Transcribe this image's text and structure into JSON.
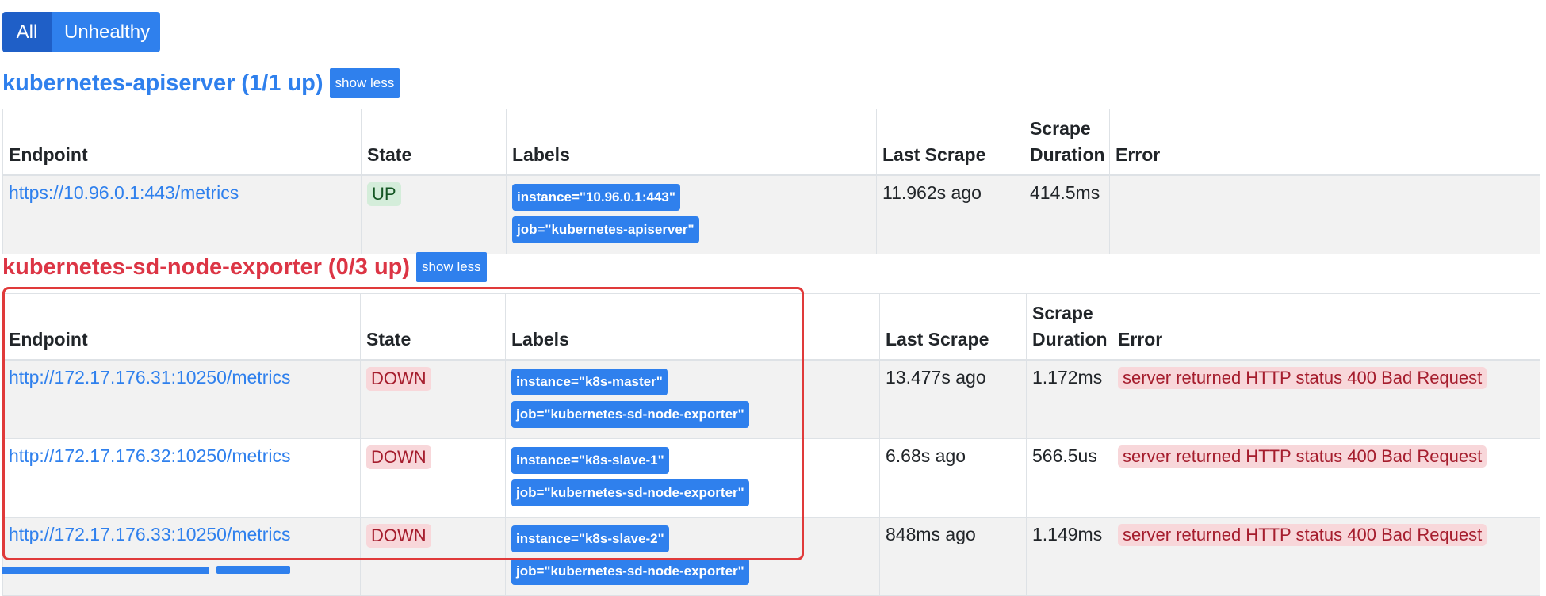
{
  "filters": {
    "all_label": "All",
    "unhealthy_label": "Unhealthy"
  },
  "columns": {
    "endpoint": "Endpoint",
    "state": "State",
    "labels": "Labels",
    "last_scrape": "Last Scrape",
    "scrape_duration": "Scrape Duration",
    "error": "Error"
  },
  "jobs": [
    {
      "title": "kubernetes-apiserver (1/1 up)",
      "toggle_label": "show less",
      "health": "healthy",
      "targets": [
        {
          "endpoint": "https://10.96.0.1:443/metrics",
          "state": "UP",
          "labels": [
            "instance=\"10.96.0.1:443\"",
            "job=\"kubernetes-apiserver\""
          ],
          "last_scrape": "11.962s ago",
          "scrape_duration": "414.5ms",
          "error": ""
        }
      ]
    },
    {
      "title": "kubernetes-sd-node-exporter (0/3 up)",
      "toggle_label": "show less",
      "health": "unhealthy",
      "targets": [
        {
          "endpoint": "http://172.17.176.31:10250/metrics",
          "state": "DOWN",
          "labels": [
            "instance=\"k8s-master\"",
            "job=\"kubernetes-sd-node-exporter\""
          ],
          "last_scrape": "13.477s ago",
          "scrape_duration": "1.172ms",
          "error": "server returned HTTP status 400 Bad Request"
        },
        {
          "endpoint": "http://172.17.176.32:10250/metrics",
          "state": "DOWN",
          "labels": [
            "instance=\"k8s-slave-1\"",
            "job=\"kubernetes-sd-node-exporter\""
          ],
          "last_scrape": "6.68s ago",
          "scrape_duration": "566.5us",
          "error": "server returned HTTP status 400 Bad Request"
        },
        {
          "endpoint": "http://172.17.176.33:10250/metrics",
          "state": "DOWN",
          "labels": [
            "instance=\"k8s-slave-2\"",
            "job=\"kubernetes-sd-node-exporter\""
          ],
          "last_scrape": "848ms ago",
          "scrape_duration": "1.149ms",
          "error": "server returned HTTP status 400 Bad Request"
        }
      ]
    }
  ],
  "colors": {
    "primary": "#2f80ed",
    "primary_active": "#1f5fc7",
    "danger": "#dc3545",
    "highlight_outline": "#e03a3a"
  }
}
